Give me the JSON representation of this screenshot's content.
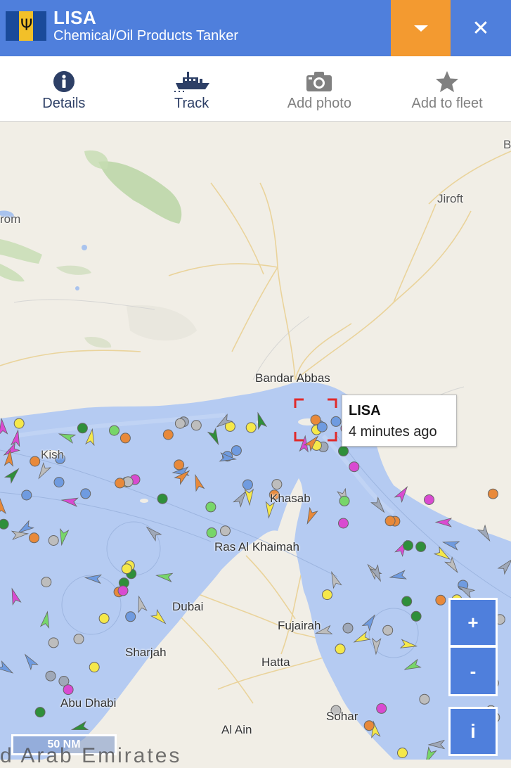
{
  "vessel": {
    "name": "LISA",
    "type": "Chemical/Oil Products Tanker",
    "flag_icon": "barbados-flag-icon",
    "colors": {
      "header": "#4f7fdc",
      "dropdown": "#f39a30"
    }
  },
  "actions": [
    {
      "label": "Details",
      "icon": "info-icon"
    },
    {
      "label": "Track",
      "icon": "ship-icon"
    },
    {
      "label": "Add photo",
      "icon": "camera-icon"
    },
    {
      "label": "Add to fleet",
      "icon": "star-icon"
    }
  ],
  "map": {
    "places": [
      "Jiroft",
      "rom",
      "B",
      "Bandar Abbas",
      "Kish",
      "Khasab",
      "Ras Al Khaimah",
      "Dubai",
      "Fujairah",
      "Hatta",
      "Sharjah",
      "Abu Dhabi",
      "Sohar",
      "Al Ain"
    ],
    "popup": {
      "name": "LISA",
      "time": "4 minutes ago"
    },
    "zoom_in": "+",
    "zoom_out": "-",
    "info": "i",
    "scale": "50 NM",
    "country": "d Arab Emirates"
  }
}
